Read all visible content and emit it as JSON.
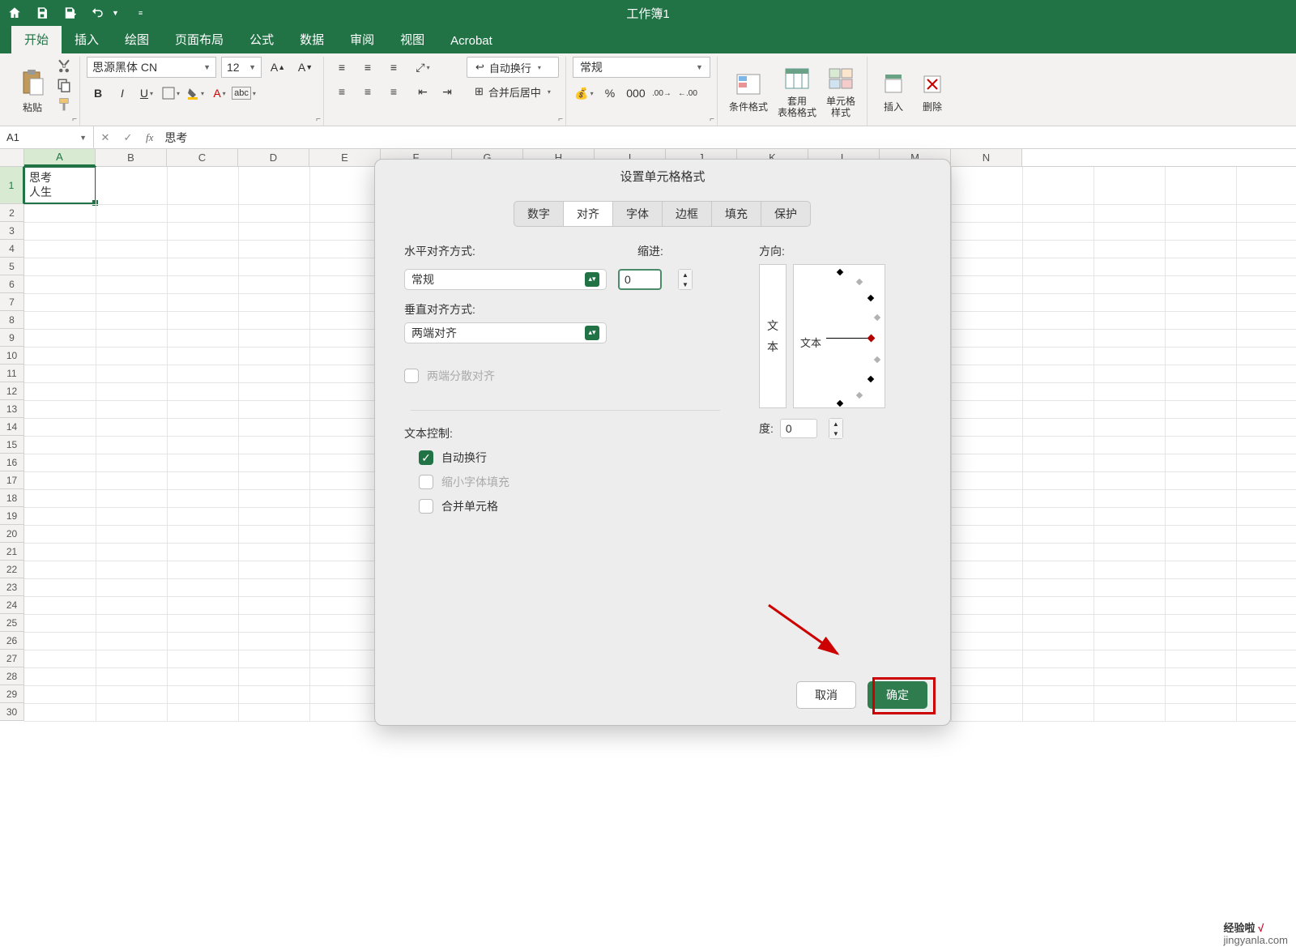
{
  "titlebar": {
    "workbook_title": "工作簿1"
  },
  "ribbon": {
    "tabs": [
      "开始",
      "插入",
      "绘图",
      "页面布局",
      "公式",
      "数据",
      "审阅",
      "视图",
      "Acrobat"
    ],
    "active_tab": 0,
    "clipboard": {
      "paste_label": "粘贴"
    },
    "font": {
      "name": "思源黑体 CN",
      "size": "12"
    },
    "align": {
      "wrap_label": "自动换行",
      "merge_label": "合并后居中"
    },
    "number": {
      "format": "常规"
    },
    "styles": {
      "cond_format": "条件格式",
      "table_format": "套用\n表格格式",
      "cell_styles": "单元格\n样式"
    },
    "cells": {
      "insert": "插入",
      "delete": "删除"
    }
  },
  "namebox": "A1",
  "formula": "思考",
  "sheet": {
    "columns": [
      "A",
      "B",
      "C",
      "D",
      "E",
      "F",
      "G",
      "H",
      "I",
      "J",
      "K",
      "L",
      "M",
      "N"
    ],
    "rows": 30,
    "cellA1_line1": "思考",
    "cellA1_line2": "人生"
  },
  "dialog": {
    "title": "设置单元格格式",
    "tabs": [
      "数字",
      "对齐",
      "字体",
      "边框",
      "填充",
      "保护"
    ],
    "active_tab": 1,
    "h_align_label": "水平对齐方式:",
    "h_align_value": "常规",
    "indent_label": "缩进:",
    "indent_value": "0",
    "v_align_label": "垂直对齐方式:",
    "v_align_value": "两端对齐",
    "justify_label": "两端分散对齐",
    "orient_label": "方向:",
    "vtext_1": "文",
    "vtext_2": "本",
    "htext": "文本",
    "degree_label": "度:",
    "degree_value": "0",
    "text_control_label": "文本控制:",
    "wrap": "自动换行",
    "shrink": "缩小字体填充",
    "merge": "合并单元格",
    "cancel": "取消",
    "ok": "确定"
  },
  "watermark": {
    "line1": "经验啦",
    "line2": "jingyanla.com"
  }
}
